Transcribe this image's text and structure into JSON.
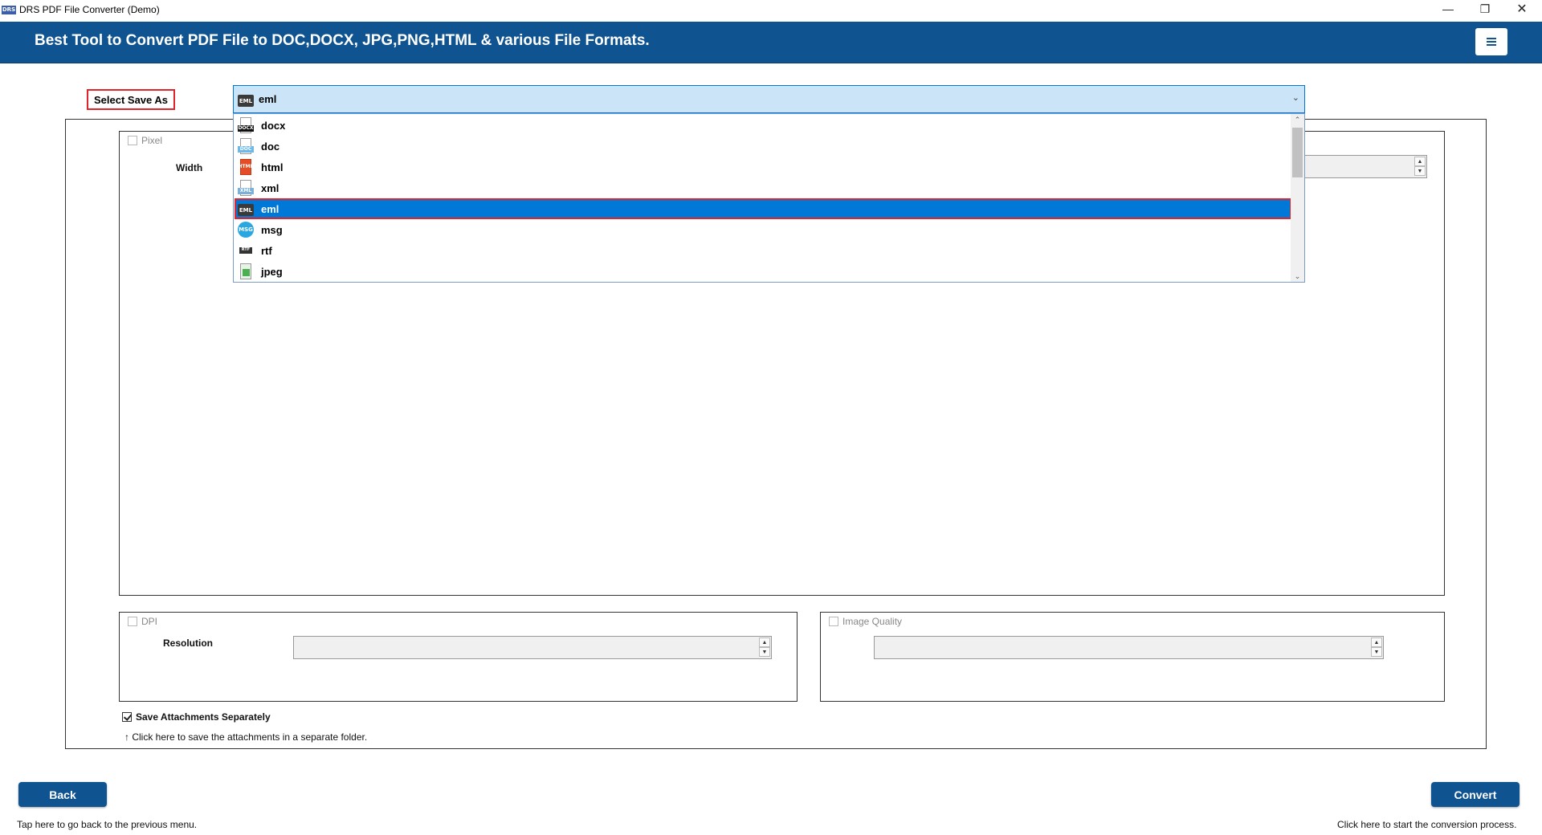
{
  "window": {
    "app_icon_text": "DRS",
    "title": "DRS PDF File Converter (Demo)",
    "minimize_glyph": "—",
    "maximize_glyph": "❐",
    "close_glyph": "✕"
  },
  "header": {
    "title": "Best Tool to Convert PDF File to DOC,DOCX, JPG,PNG,HTML & various File Formats.",
    "menu_icon": "hamburger-icon"
  },
  "save_as": {
    "label": "Select Save As",
    "selected_value": "eml",
    "selected_icon_tag": "EML",
    "options": [
      {
        "label": "docx",
        "icon": "docx-file-icon",
        "tag": "DOCX"
      },
      {
        "label": "doc",
        "icon": "doc-file-icon",
        "tag": "DOC"
      },
      {
        "label": "html",
        "icon": "html-file-icon",
        "tag": "HTML"
      },
      {
        "label": "xml",
        "icon": "xml-file-icon",
        "tag": "XML"
      },
      {
        "label": "eml",
        "icon": "eml-file-icon",
        "tag": "EML",
        "selected": true
      },
      {
        "label": "msg",
        "icon": "msg-file-icon",
        "tag": "MSG"
      },
      {
        "label": "rtf",
        "icon": "rtf-file-icon",
        "tag": "RTF"
      },
      {
        "label": "jpeg",
        "icon": "jpeg-file-icon",
        "tag": ""
      }
    ]
  },
  "pixel": {
    "checkbox_label": "Pixel",
    "width_label": "Width",
    "checked": false
  },
  "dpi": {
    "checkbox_label": "DPI",
    "resolution_label": "Resolution",
    "checked": false
  },
  "image_quality": {
    "checkbox_label": "Image Quality",
    "checked": false
  },
  "attachments": {
    "checkbox_label": "Save Attachments Separately",
    "checked": true,
    "hint": "↑ Click here to save the attachments in a separate folder."
  },
  "footer": {
    "back_label": "Back",
    "back_hint": "Tap here to go back to the previous menu.",
    "convert_label": "Convert",
    "convert_hint": "Click here to start the conversion process."
  },
  "colors": {
    "header_bg": "#0f5391",
    "accent": "#0078d7",
    "highlight_border": "#e0242c"
  }
}
